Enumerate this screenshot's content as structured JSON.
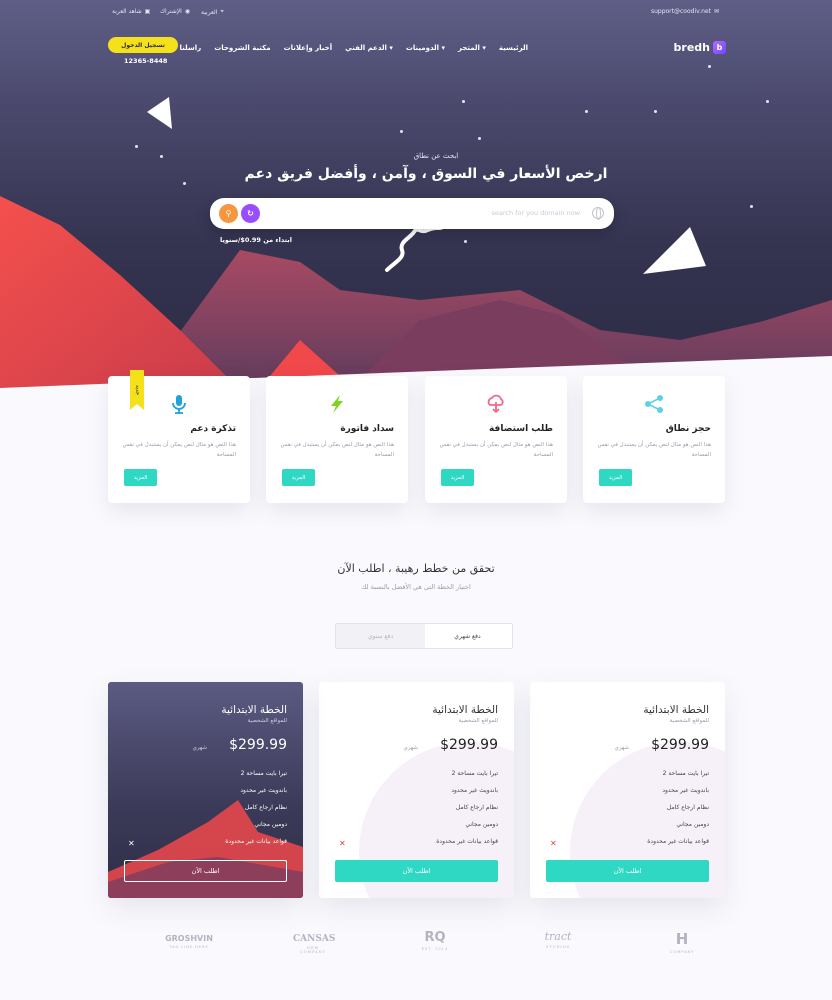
{
  "topbar": {
    "email": "support@coodiv.net",
    "language": "العربية",
    "support": "الإشتراك",
    "cart": "شاهد العربة"
  },
  "nav": {
    "logo_text": "bredh",
    "logo_mark": "b",
    "items": [
      "الرئيسية",
      "المتجر",
      "الدومينات",
      "الدعم الفني",
      "أخبار وإعلانات",
      "مكتبة الشروحات",
      "راسلنا"
    ],
    "login": "تسجيل الدخول",
    "phone": "12365-8448"
  },
  "hero": {
    "subtitle": "ابحث عن نطاق",
    "title": "ارخص الأسعار في السوق ، وآمن ، وأفضل فريق دعم",
    "search_placeholder": "search for you domain now",
    "price_note": "ابتداء من 0.99$/سنويا"
  },
  "features": [
    {
      "title": "حجز نطاق",
      "text": "هذا النص هو مثال لنص يمكن أن يستبدل في نفس المساحة",
      "button": "المزيد",
      "icon": "share-icon",
      "color": "#5bd3e6"
    },
    {
      "title": "طلب استضافة",
      "text": "هذا النص هو مثال لنص يمكن أن يستبدل في نفس المساحة",
      "button": "المزيد",
      "icon": "cloud-download-icon",
      "color": "#f06a8a"
    },
    {
      "title": "سداد فاتورة",
      "text": "هذا النص هو مثال لنص يمكن أن يستبدل في نفس المساحة",
      "button": "المزيد",
      "icon": "lightning-icon",
      "color": "#7ed321"
    },
    {
      "title": "تذكرة دعم",
      "text": "هذا النص هو مثال لنص يمكن أن يستبدل في نفس المساحة",
      "button": "المزيد",
      "icon": "microphone-icon",
      "color": "#1fa3d8",
      "ribbon": "جديد"
    }
  ],
  "plans_section": {
    "title": "تحقق من خطط رهيبة ، اطلب الآن",
    "subtitle": "اختيار الخطة التى هي الأفضل بالنسبة لك",
    "toggle_monthly": "دفع شهري",
    "toggle_yearly": "دفع سنوي"
  },
  "plans": [
    {
      "title": "الخطة الابتدائية",
      "subtitle": "للمواقع الشخصية",
      "price": "$299.99",
      "period": "شهري",
      "features": [
        "2 تيرا بايت مساحة",
        "باندويث غير محدود",
        "نظام ارجاع كامل",
        "دومين مجاني",
        "قواعد بيانات غير محدودة"
      ],
      "button": "اطلب الآن",
      "style": "light"
    },
    {
      "title": "الخطة الابتدائية",
      "subtitle": "للمواقع الشخصية",
      "price": "$299.99",
      "period": "شهري",
      "features": [
        "2 تيرا بايت مساحة",
        "باندويث غير محدود",
        "نظام ارجاع كامل",
        "دومين مجاني",
        "قواعد بيانات غير محدودة"
      ],
      "button": "اطلب الآن",
      "style": "light"
    },
    {
      "title": "الخطة الابتدائية",
      "subtitle": "للمواقع الشخصية",
      "price": "$299.99",
      "period": "شهري",
      "features": [
        "2 تيرا بايت مساحة",
        "باندويث غير محدود",
        "نظام ارجاع كامل",
        "دومين مجاني",
        "قواعد بيانات غير محدودة"
      ],
      "button": "اطلب الآن",
      "style": "dark"
    }
  ],
  "brands": [
    {
      "name": "GROSHVIN",
      "tag": "TAG LINE HERE"
    },
    {
      "name": "CANSAS",
      "tag": "NEW COMPANY"
    },
    {
      "name": "RQ",
      "tag": "EST. 2014"
    },
    {
      "name": "tract",
      "tag": "STUDIOS"
    },
    {
      "name": "H",
      "tag": "COMPANY"
    }
  ],
  "colors": {
    "accent": "#2ed8c3",
    "login_button": "#f5e11b",
    "mountain": "#f0484b",
    "hero_bg": "#353451"
  }
}
